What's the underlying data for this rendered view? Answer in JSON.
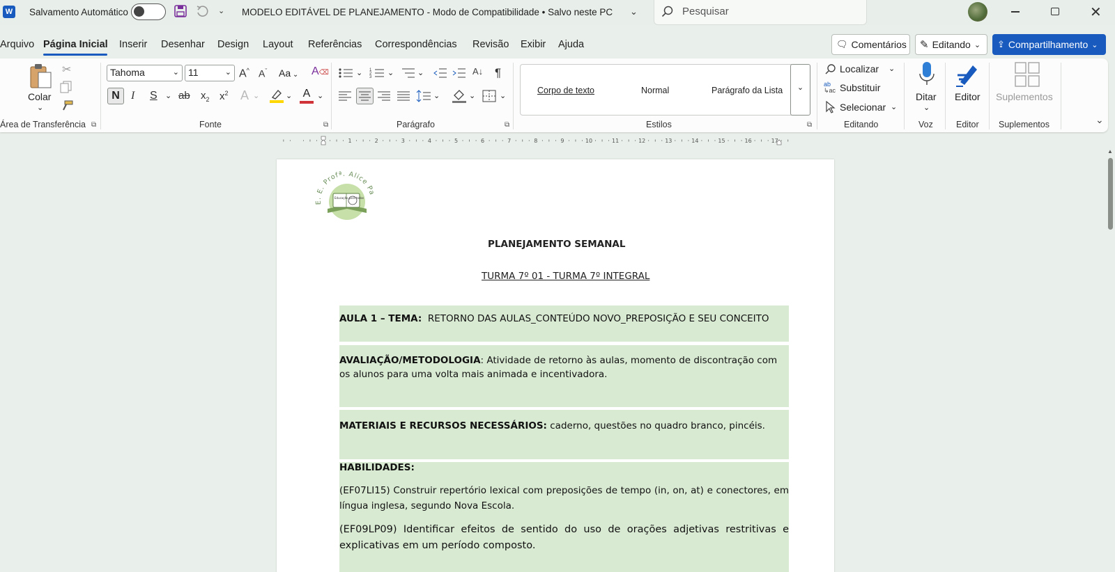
{
  "titlebar": {
    "autosave_label": "Salvamento Automático",
    "document_title": "MODELO EDITÁVEL DE PLANEJAMENTO  -  Modo de Compatibilidade • Salvo neste PC",
    "search_placeholder": "Pesquisar"
  },
  "menu": {
    "items": [
      "Arquivo",
      "Página Inicial",
      "Inserir",
      "Desenhar",
      "Design",
      "Layout",
      "Referências",
      "Correspondências",
      "Revisão",
      "Exibir",
      "Ajuda"
    ],
    "active": "Página Inicial",
    "comments_label": "Comentários",
    "editing_label": "Editando",
    "share_label": "Compartilhamento"
  },
  "ribbon": {
    "clipboard": {
      "paste_label": "Colar",
      "group_label": "Área de Transferência"
    },
    "font": {
      "font_name": "Tahoma",
      "font_size": "11",
      "change_case": "Aa",
      "bold": "N",
      "italic": "I",
      "underline": "S",
      "strike": "ab",
      "sub": "x",
      "sup": "x",
      "font_color": "A",
      "group_label": "Fonte"
    },
    "paragraph": {
      "pilcrow": "¶",
      "group_label": "Parágrafo"
    },
    "styles": {
      "items": [
        "Corpo de texto",
        "Normal",
        "Parágrafo da Lista"
      ],
      "group_label": "Estilos"
    },
    "editing": {
      "find_label": "Localizar",
      "replace_label": "Substituir",
      "select_label": "Selecionar",
      "group_label": "Editando"
    },
    "voice": {
      "dictate_label": "Ditar",
      "group_label": "Voz"
    },
    "editor": {
      "editor_label": "Editor",
      "group_label": "Editor"
    },
    "addins": {
      "addins_label": "Suplementos",
      "group_label": "Suplementos"
    }
  },
  "ruler": {
    "numbers": [
      "1",
      "2",
      "3",
      "4",
      "5",
      "6",
      "7",
      "8",
      "9",
      "10",
      "11",
      "12",
      "13",
      "14",
      "15",
      "16",
      "17"
    ]
  },
  "document": {
    "logo_text": "E. E. Profª. Alice Paes",
    "logo_book_text": "Educação para todos",
    "title": "PLANEJAMENTO SEMANAL",
    "subtitle": "TURMA 7º 01 - TURMA 7º INTEGRAL",
    "aula_label": "AULA 1 – TEMA:",
    "aula_text": "RETORNO DAS AULAS_CONTEÚDO NOVO_PREPOSIÇÃO E SEU CONCEITO",
    "avaliacao_label": "AVALIAÇÃO/METODOLOGIA",
    "avaliacao_text": ": Atividade de retorno às aulas, momento de discontração com os alunos para uma volta mais animada e incentivadora.",
    "materiais_label": "MATERIAIS E RECURSOS NECESSÁRIOS:",
    "materiais_text": " caderno, questões no quadro branco, pincéis.",
    "habilidades_label": "HABILIDADES:",
    "habilidade_1": "(EF07LI15) Construir repertório lexical com preposições de tempo (in, on, at) e conectores, em língua inglesa, segundo Nova Escola.",
    "habilidade_2": "(EF09LP09) Identificar efeitos de sentido do uso de orações adjetivas restritivas e explicativas em um período composto."
  },
  "colors": {
    "accent": "#185abd",
    "highlight_block": "#d9ead3",
    "word_blue": "#185abd",
    "font_color_bar": "#d13438",
    "highlight_bar": "#ffd700"
  }
}
